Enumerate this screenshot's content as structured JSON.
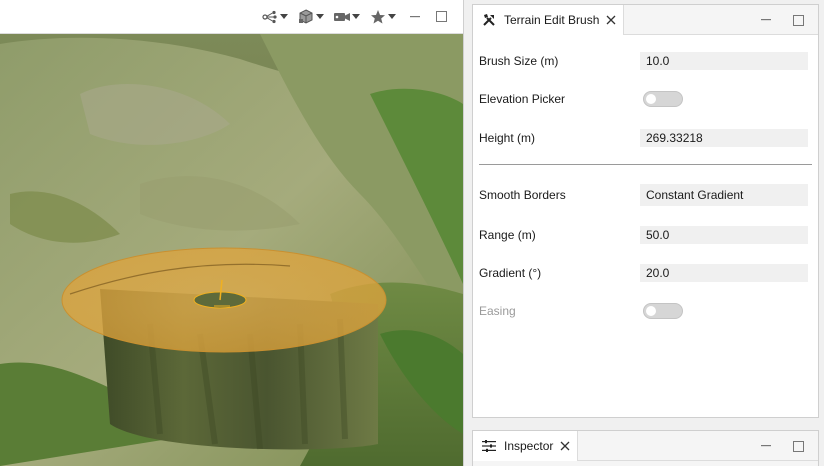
{
  "viewport": {
    "toolbar_icons": [
      "share-nodes-icon",
      "cube-icon",
      "camera-icon",
      "star-icon"
    ],
    "controls": [
      "minimize-icon",
      "maximize-icon"
    ]
  },
  "panel": {
    "tab_icon": "tools-icon",
    "tab_label": "Terrain Edit Brush",
    "rows": {
      "brush_size": {
        "label": "Brush Size (m)",
        "value": "10.0"
      },
      "elevation_picker": {
        "label": "Elevation Picker",
        "toggle_on": false
      },
      "height": {
        "label": "Height (m)",
        "value": "269.33218"
      },
      "smooth_borders": {
        "label": "Smooth Borders",
        "value": "Constant Gradient"
      },
      "range": {
        "label": "Range (m)",
        "value": "50.0"
      },
      "gradient": {
        "label": "Gradient (°)",
        "value": "20.0"
      },
      "easing": {
        "label": "Easing",
        "toggle_on": false,
        "disabled": true
      }
    }
  },
  "inspector": {
    "tab_icon": "sliders-icon",
    "tab_label": "Inspector"
  },
  "colors": {
    "brush_fill": "#e0a33a",
    "terrain_dark": "#4e5a33",
    "terrain_light": "#93a068"
  }
}
